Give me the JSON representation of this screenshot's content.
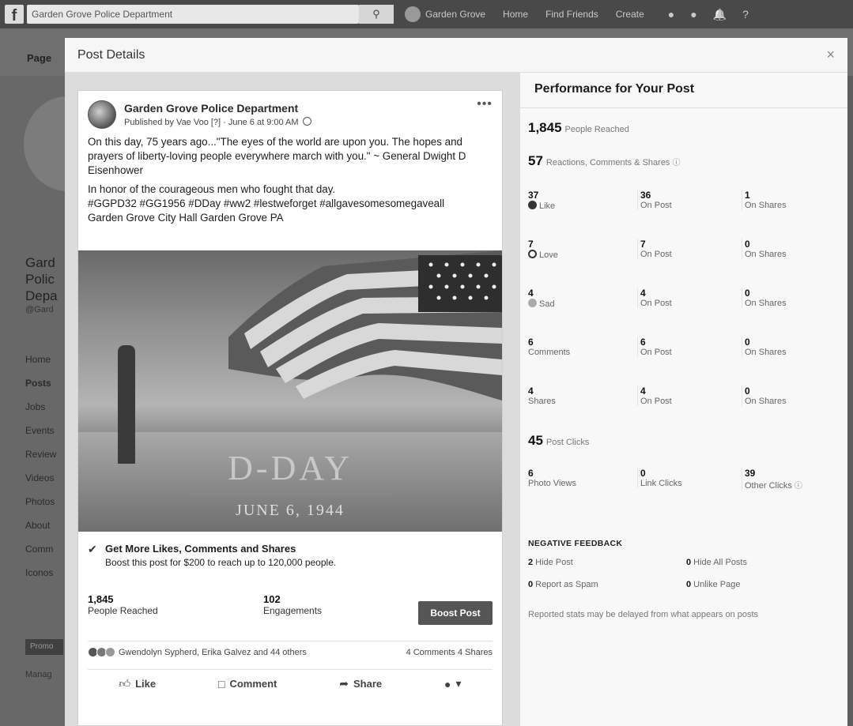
{
  "topbar": {
    "search_value": "Garden Grove Police Department",
    "search_icon": "search-icon",
    "profile_name": "Garden Grove",
    "links": [
      "Home",
      "Find Friends",
      "Create"
    ]
  },
  "background": {
    "tab": "Page",
    "page_name_lines": [
      "Gard",
      "Polic",
      "Depa"
    ],
    "handle": "@Gard",
    "nav": [
      "Home",
      "Posts",
      "Jobs",
      "Events",
      "Review",
      "Videos",
      "Photos",
      "About",
      "Comm",
      "Iconos"
    ],
    "promote": "Promo",
    "manage": "Manag"
  },
  "modal": {
    "title": "Post Details",
    "close": "×"
  },
  "post": {
    "page_name": "Garden Grove Police Department",
    "published": "Published by Vae Voo [?] · June 6 at 9:00 AM",
    "menu": "•••",
    "text_paragraph_1": "On this day, 75 years ago...\"The eyes of the world are upon you. The hopes and prayers of liberty-loving people everywhere march with you.\" ~ General Dwight D Eisenhower",
    "text_paragraph_2": "In honor of the courageous men who fought that day.",
    "text_paragraph_3": "#GGPD32 #GG1956 #DDay #ww2 #lestweforget #allgavesomesomegaveall",
    "text_paragraph_4": "Garden Grove City Hall Garden Grove PA",
    "image_title": "D-DAY",
    "image_date": "JUNE 6, 1944",
    "promo_title": "Get More Likes, Comments and Shares",
    "promo_sub": "Boost this post for $200 to reach up to 120,000 people.",
    "reached_num": "1,845",
    "reached_label": "People Reached",
    "engagements_num": "102",
    "engagements_label": "Engagements",
    "boost_label": "Boost Post",
    "reactors": "Gwendolyn Sypherd, Erika Galvez and 44 others",
    "comments_shares": "4 Comments  4 Shares",
    "actions": {
      "like": "Like",
      "comment": "Comment",
      "share": "Share"
    }
  },
  "performance": {
    "title": "Performance for Your Post",
    "reached_num": "1,845",
    "reached_label": "People Reached",
    "rcs_num": "57",
    "rcs_label": "Reactions, Comments & Shares",
    "rows": [
      {
        "n1": "37",
        "l1": "Like",
        "n2": "36",
        "l2": "On Post",
        "n3": "1",
        "l3": "On Shares"
      },
      {
        "n1": "7",
        "l1": "Love",
        "n2": "7",
        "l2": "On Post",
        "n3": "0",
        "l3": "On Shares"
      },
      {
        "n1": "4",
        "l1": "Sad",
        "n2": "4",
        "l2": "On Post",
        "n3": "0",
        "l3": "On Shares"
      },
      {
        "n1": "6",
        "l1": "Comments",
        "n2": "6",
        "l2": "On Post",
        "n3": "0",
        "l3": "On Shares"
      },
      {
        "n1": "4",
        "l1": "Shares",
        "n2": "4",
        "l2": "On Post",
        "n3": "0",
        "l3": "On Shares"
      }
    ],
    "clicks_num": "45",
    "clicks_label": "Post Clicks",
    "clicks_row": {
      "n1": "6",
      "l1": "Photo Views",
      "n2": "0",
      "l2": "Link Clicks",
      "n3": "39",
      "l3": "Other Clicks"
    },
    "negative_title": "NEGATIVE FEEDBACK",
    "neg": [
      {
        "n": "2",
        "label": "Hide Post"
      },
      {
        "n": "0",
        "label": "Hide All Posts"
      },
      {
        "n": "0",
        "label": "Report as Spam"
      },
      {
        "n": "0",
        "label": "Unlike Page"
      }
    ],
    "delay_note": "Reported stats may be delayed from what appears on posts"
  }
}
